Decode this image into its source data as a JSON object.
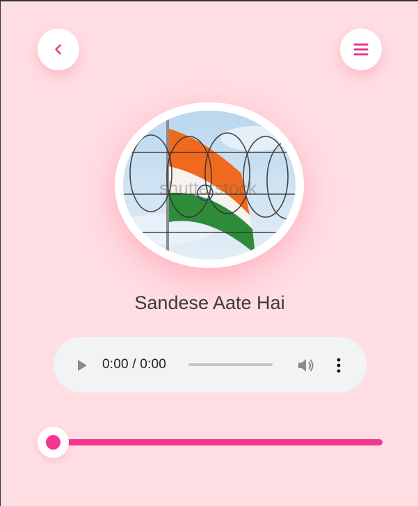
{
  "nav": {
    "back_icon": "chevron-left-icon",
    "menu_icon": "hamburger-menu-icon"
  },
  "track": {
    "title": "Sandese Aate Hai",
    "artwork": "indian-flag-barbed-wire",
    "watermark": "shutterstock"
  },
  "player": {
    "time": "0:00 / 0:00",
    "play_icon": "play-icon",
    "volume_icon": "volume-icon",
    "more_icon": "more-vertical-icon"
  },
  "seek": {
    "progress": 0
  },
  "colors": {
    "background": "#ffdee3",
    "accent": "#f43591",
    "player_bg": "#f1f3f4"
  }
}
